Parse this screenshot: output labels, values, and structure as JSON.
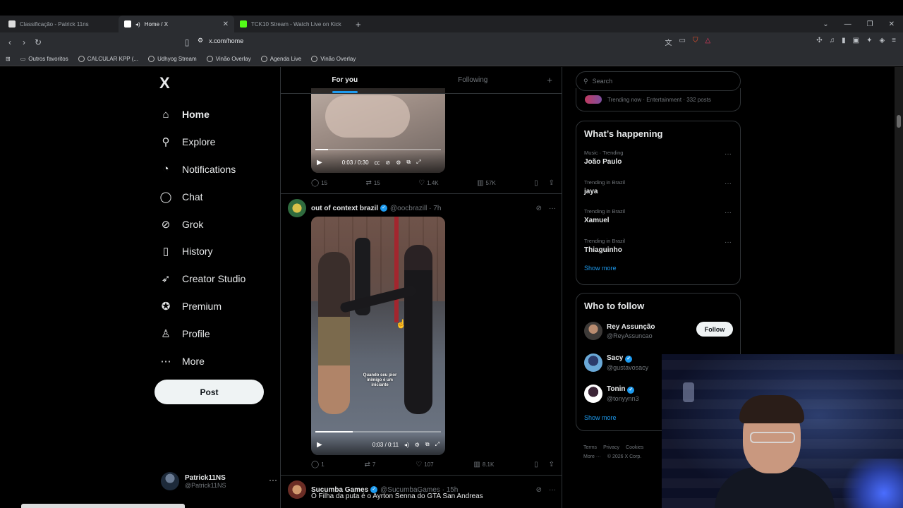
{
  "browser": {
    "tabs": [
      {
        "label": "Classificação - Patrick 11ns",
        "fav_color": "#dcdcdc",
        "active": false
      },
      {
        "label": "Home / X",
        "fav_color": "#ffffff",
        "active": true
      },
      {
        "label": "TCK10 Stream - Watch Live on Kick",
        "fav_color": "#53fc18",
        "active": false
      }
    ],
    "url": "x.com/home",
    "bookmarks": [
      "Outros favoritos",
      "CALCULAR KPP (...",
      "Udhyog Stream",
      "Vinão Overlay",
      "Agenda Live",
      "Vinão Overlay"
    ]
  },
  "sidebar": {
    "logo": "X",
    "items": [
      {
        "label": "Home",
        "icon": "home-icon",
        "glyph": "⌂"
      },
      {
        "label": "Explore",
        "icon": "search-icon",
        "glyph": "⚲"
      },
      {
        "label": "Notifications",
        "icon": "bell-icon",
        "glyph": "♫"
      },
      {
        "label": "Chat",
        "icon": "chat-icon",
        "glyph": "◯"
      },
      {
        "label": "Grok",
        "icon": "grok-icon",
        "glyph": "⊘"
      },
      {
        "label": "History",
        "icon": "bookmark-icon",
        "glyph": "▯"
      },
      {
        "label": "Creator Studio",
        "icon": "rocket-icon",
        "glyph": "➶"
      },
      {
        "label": "Premium",
        "icon": "premium-icon",
        "glyph": "✪"
      },
      {
        "label": "Profile",
        "icon": "person-icon",
        "glyph": "♙"
      },
      {
        "label": "More",
        "icon": "more-circle-icon",
        "glyph": "⋯"
      }
    ],
    "post_label": "Post",
    "account": {
      "name": "Patrick11NS",
      "handle": "@Patrick11NS"
    }
  },
  "timeline": {
    "tabs": [
      "For you",
      "Following"
    ],
    "tweet1": {
      "time": "0:03 / 0:30",
      "progress": 0.1,
      "replies": "15",
      "reposts": "15",
      "likes": "1.4K",
      "views": "57K"
    },
    "tweet2": {
      "name": "out of context brazil",
      "handle": "@oocbrazill",
      "age": "7h",
      "caption": "Quando seu pior inimigo é um iniciante",
      "time": "0:03 / 0:11",
      "progress": 0.3,
      "replies": "1",
      "reposts": "7",
      "likes": "107",
      "views": "8.1K"
    },
    "tweet3": {
      "name": "Sucumba Games",
      "handle": "@SucumbaGames",
      "age": "15h",
      "text": "O Filha da puta é o Ayrton Senna do GTA San Andreas"
    }
  },
  "right": {
    "search_placeholder": "Search",
    "trend_top": "Trending now · Entertainment · 332 posts",
    "happening_title": "What’s happening",
    "trends": [
      {
        "meta": "Music · Trending",
        "name": "João Paulo"
      },
      {
        "meta": "Trending in Brazil",
        "name": "jaya"
      },
      {
        "meta": "Trending in Brazil",
        "name": "Xamuel"
      },
      {
        "meta": "Trending in Brazil",
        "name": "Thiaguinho"
      }
    ],
    "show_more": "Show more",
    "wtf_title": "Who to follow",
    "follow_label": "Follow",
    "who_to_follow": [
      {
        "name": "Rey Assunção",
        "handle": "@ReyAssuncao",
        "verified": false
      },
      {
        "name": "Sacy",
        "handle": "@gustavosacy",
        "verified": true
      },
      {
        "name": "Tonin",
        "handle": "@tonyynn3",
        "verified": true
      }
    ],
    "footer": [
      "Terms",
      "Privacy",
      "Cookies",
      "More ···",
      "© 2026 X Corp."
    ]
  }
}
